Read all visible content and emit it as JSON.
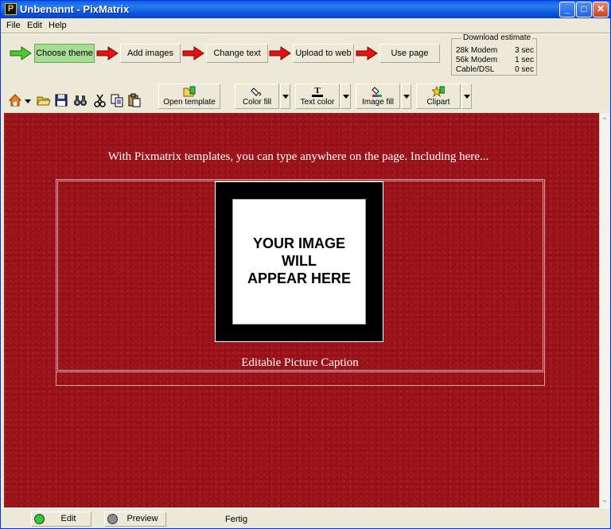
{
  "window": {
    "title": "Unbenannt - PixMatrix",
    "app_icon": "P"
  },
  "menu": [
    "File",
    "Edit",
    "Help"
  ],
  "wizard_steps": [
    {
      "label": "Choose theme",
      "active": true
    },
    {
      "label": "Add images",
      "active": false
    },
    {
      "label": "Change text",
      "active": false
    },
    {
      "label": "Upload to web",
      "active": false
    },
    {
      "label": "Use page",
      "active": false
    }
  ],
  "download_estimate": {
    "title": "Download estimate",
    "rows": [
      {
        "label": "28k Modem",
        "value": "3 sec"
      },
      {
        "label": "56k Modem",
        "value": "1 sec"
      },
      {
        "label": "Cable/DSL",
        "value": "0 sec"
      }
    ]
  },
  "toolbar": {
    "icons": [
      "home-icon",
      "dropdown-arrow-icon",
      "open-folder-icon",
      "save-disk-icon",
      "find-binoculars-icon",
      "cut-scissors-icon",
      "copy-icon",
      "paste-icon"
    ],
    "open_template": "Open template",
    "color_fill": "Color fill",
    "text_color": "Text color",
    "image_fill": "Image fill",
    "clipart": "Clipart"
  },
  "page": {
    "headline": "With Pixmatrix templates, you can type anywhere on the page. Including here...",
    "image_placeholder": [
      "YOUR IMAGE",
      "WILL",
      "APPEAR HERE"
    ],
    "caption": "Editable Picture Caption",
    "background_color": "#9c1218"
  },
  "status": {
    "edit_label": "Edit",
    "preview_label": "Preview",
    "message": "Fertig",
    "edit_indicator_color": "#2ecc2e",
    "preview_indicator_color": "#8c8c8c"
  }
}
